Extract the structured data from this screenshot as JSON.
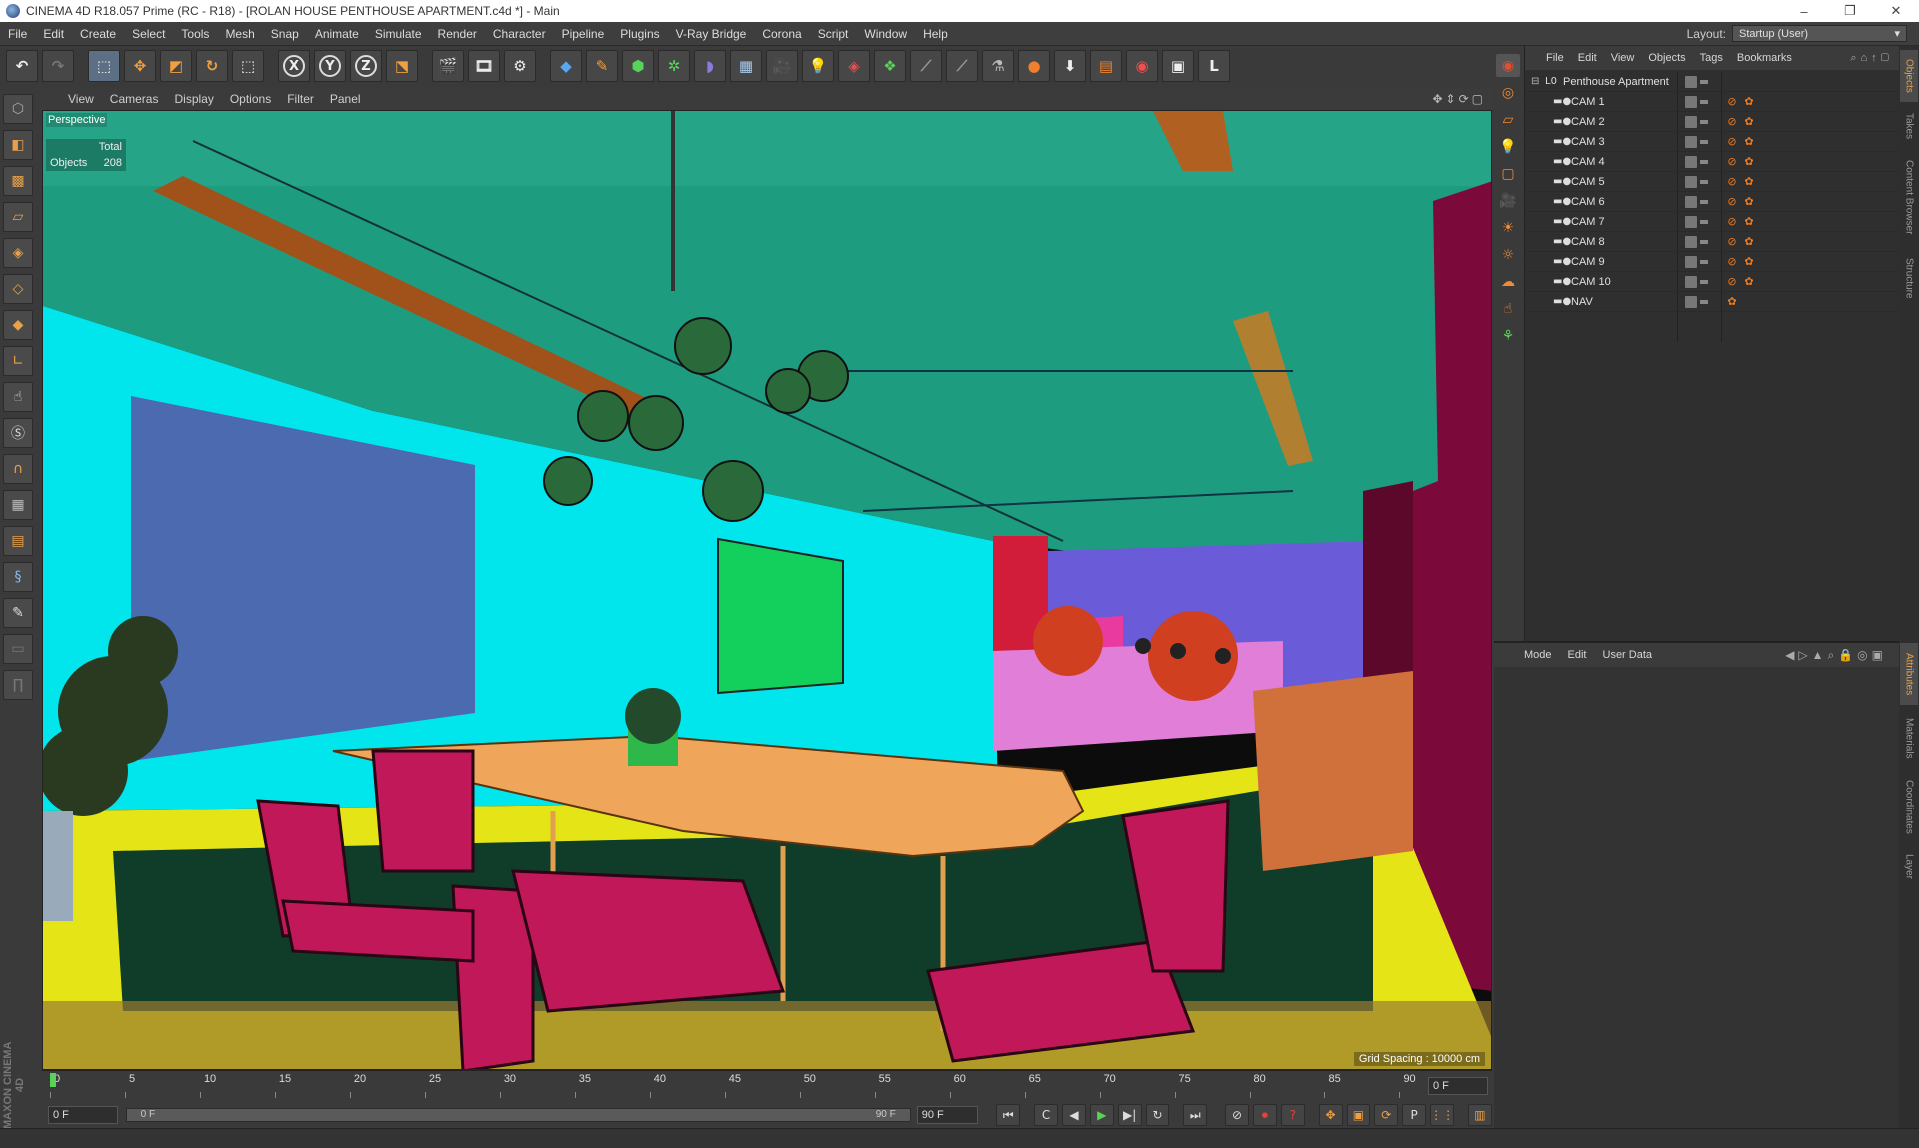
{
  "window": {
    "title": "CINEMA 4D R18.057 Prime (RC - R18) - [ROLAN HOUSE PENTHOUSE APARTMENT.c4d *] - Main",
    "controls": [
      "–",
      "❐",
      "✕"
    ]
  },
  "menubar": {
    "items": [
      "File",
      "Edit",
      "Create",
      "Select",
      "Tools",
      "Mesh",
      "Snap",
      "Animate",
      "Simulate",
      "Render",
      "Character",
      "Pipeline",
      "Plugins",
      "V-Ray Bridge",
      "Corona",
      "Script",
      "Window",
      "Help"
    ],
    "layout_label": "Layout:",
    "layout_value": "Startup (User)"
  },
  "toolbar": {
    "axis_x": "X",
    "axis_y": "Y",
    "axis_z": "Z",
    "icons": [
      "undo-icon",
      "redo-icon",
      "live-selection-icon",
      "move-icon",
      "scale-icon",
      "rotate-icon",
      "recent-tool-icon",
      "x-axis-lock",
      "y-axis-lock",
      "z-axis-lock",
      "coordinate-system-icon",
      "render-view-icon",
      "render-picture-viewer-icon",
      "render-settings-icon",
      "cube-icon",
      "pen-icon",
      "subdivision-icon",
      "array-icon",
      "deformer-icon",
      "floor-icon",
      "camera-icon",
      "light-icon",
      "tags-icon",
      "hair-icon",
      "sketch-icon",
      "mograph-icon",
      "vray-icon",
      "corona-icon",
      "download-icon",
      "render-icon",
      "color-icon",
      "material-icon",
      "frame-icon"
    ]
  },
  "viewport": {
    "menu": [
      "View",
      "Cameras",
      "Display",
      "Options",
      "Filter",
      "Panel"
    ],
    "label": "Perspective",
    "hud_header": "Total",
    "hud_objects_label": "Objects",
    "hud_objects_value": "208",
    "grid_spacing": "Grid Spacing : 10000 cm",
    "colors": {
      "ceiling": "#1e9c80",
      "ceiling_band": "#2aa88a",
      "left_wall": "#00e6ec",
      "painting": "#4b6ab0",
      "tv": "#13cf5c",
      "floor": "#e4e417",
      "floor_shadow": "#0f3d2a",
      "column": "#7b0a3a",
      "table": "#efa55a",
      "chair": "#c01858",
      "kitchen_back": "#6a5bd8",
      "kitchen_pink": "#e93aa0",
      "kitchen_red": "#d11c3a",
      "stool": "#d04020",
      "sofa": "#d0703a"
    }
  },
  "timeline": {
    "ticks": [
      "0",
      "5",
      "10",
      "15",
      "20",
      "25",
      "30",
      "35",
      "40",
      "45",
      "50",
      "55",
      "60",
      "65",
      "70",
      "75",
      "80",
      "85",
      "90"
    ],
    "current_frame": "0 F",
    "start_frame": "0 F",
    "range_start": "0 F",
    "range_end": "90 F",
    "end_frame": "90 F"
  },
  "transport": {
    "buttons": [
      "⏮",
      "C",
      "◀",
      "▶",
      "▶|",
      "↻",
      "⏭"
    ],
    "extra": [
      "⊘",
      "⏺",
      "?",
      "✥",
      "▣",
      "⟳",
      "P",
      "⋮⋮"
    ]
  },
  "objects_panel": {
    "menu": [
      "File",
      "Edit",
      "View",
      "Objects",
      "Tags",
      "Bookmarks"
    ],
    "items": [
      {
        "name": "Penthouse Apartment",
        "type": "null",
        "expanded": true
      },
      {
        "name": "CAM 1",
        "type": "camera"
      },
      {
        "name": "CAM 2",
        "type": "camera"
      },
      {
        "name": "CAM 3",
        "type": "camera"
      },
      {
        "name": "CAM 4",
        "type": "camera"
      },
      {
        "name": "CAM 5",
        "type": "camera"
      },
      {
        "name": "CAM 6",
        "type": "camera"
      },
      {
        "name": "CAM 7",
        "type": "camera"
      },
      {
        "name": "CAM 8",
        "type": "camera"
      },
      {
        "name": "CAM 9",
        "type": "camera"
      },
      {
        "name": "CAM 10",
        "type": "camera"
      },
      {
        "name": "NAV",
        "type": "camera"
      }
    ]
  },
  "attributes_panel": {
    "menu": [
      "Mode",
      "Edit",
      "User Data"
    ]
  },
  "side_tabs": {
    "top": [
      "Objects",
      "Takes",
      "Content Browser",
      "Structure"
    ],
    "bottom": [
      "Attributes",
      "Materials",
      "Coordinates",
      "Layer"
    ]
  },
  "branding": "MAXON CINEMA 4D"
}
